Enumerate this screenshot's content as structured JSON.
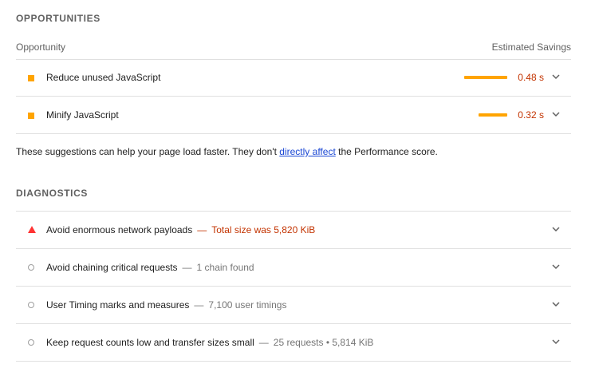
{
  "opportunities": {
    "section_title": "OPPORTUNITIES",
    "col_left": "Opportunity",
    "col_right": "Estimated Savings",
    "items": [
      {
        "title": "Reduce unused JavaScript",
        "savings": "0.48 s",
        "bar_fraction": 1.0
      },
      {
        "title": "Minify JavaScript",
        "savings": "0.32 s",
        "bar_fraction": 0.67
      }
    ],
    "note_before": "These suggestions can help your page load faster. They don't ",
    "note_link": "directly affect",
    "note_after": " the Performance score."
  },
  "diagnostics": {
    "section_title": "DIAGNOSTICS",
    "items": [
      {
        "title": "Avoid enormous network payloads",
        "dash": "—",
        "detail": "Total size was 5,820 KiB",
        "status": "fail"
      },
      {
        "title": "Avoid chaining critical requests",
        "dash": "—",
        "detail": "1 chain found",
        "status": "info"
      },
      {
        "title": "User Timing marks and measures",
        "dash": "—",
        "detail": "7,100 user timings",
        "status": "info"
      },
      {
        "title": "Keep request counts low and transfer sizes small",
        "dash": "—",
        "detail": "25 requests • 5,814 KiB",
        "status": "info"
      }
    ]
  },
  "colors": {
    "orange": "#ffa400",
    "red": "#ff3333",
    "savings_text": "#c33300",
    "link": "#1a47d4"
  },
  "icons": {
    "expand": "chevron-down-icon",
    "opportunity": "orange-square-icon",
    "fail": "red-triangle-icon",
    "info": "grey-circle-icon"
  }
}
